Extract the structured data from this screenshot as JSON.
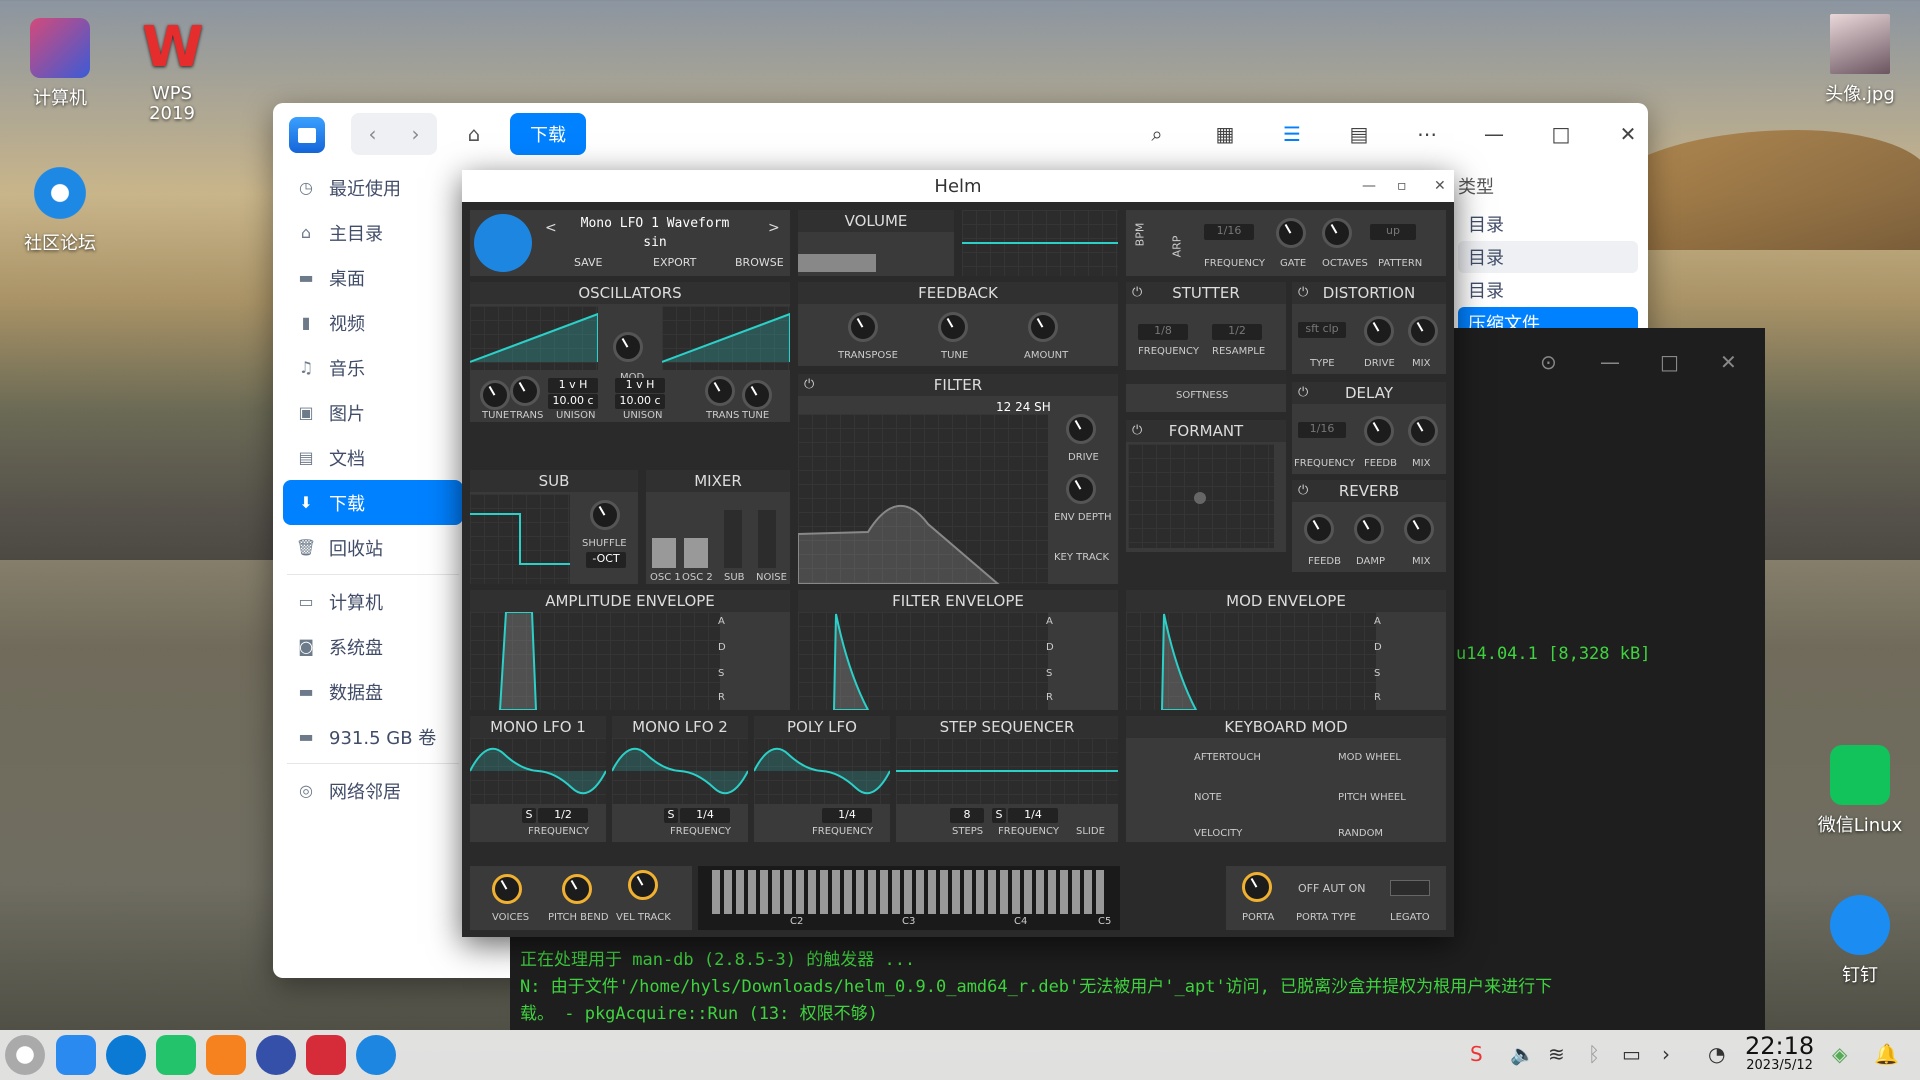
{
  "desktop": {
    "icons": [
      {
        "label": "计算机"
      },
      {
        "label": "WPS 2019"
      },
      {
        "label": "社区论坛"
      },
      {
        "label": "头像.jpg"
      },
      {
        "label": "微信Linux"
      },
      {
        "label": "钉钉"
      }
    ]
  },
  "file_manager": {
    "breadcrumb": "下载",
    "sidebar": [
      {
        "label": "最近使用",
        "icon": "clock-icon"
      },
      {
        "label": "主目录",
        "icon": "home-icon"
      },
      {
        "label": "桌面",
        "icon": "desktop-icon"
      },
      {
        "label": "视频",
        "icon": "video-icon"
      },
      {
        "label": "音乐",
        "icon": "music-icon"
      },
      {
        "label": "图片",
        "icon": "picture-icon"
      },
      {
        "label": "文档",
        "icon": "document-icon"
      },
      {
        "label": "下载",
        "icon": "download-icon",
        "active": true
      },
      {
        "label": "回收站",
        "icon": "trash-icon"
      },
      {
        "label": "计算机",
        "icon": "computer-icon"
      },
      {
        "label": "系统盘",
        "icon": "disk-icon"
      },
      {
        "label": "数据盘",
        "icon": "disk-icon"
      },
      {
        "label": "931.5 GB 卷",
        "icon": "disk-icon"
      },
      {
        "label": "网络邻居",
        "icon": "network-icon"
      }
    ],
    "type_header": "类型",
    "type_rows": [
      "目录",
      "目录",
      "目录",
      "压缩文件"
    ]
  },
  "terminal": {
    "line_version": "u14.04.1 [8,328 kB]",
    "line1": "正在处理用于 man-db (2.8.5-3) 的触发器 ...",
    "line2": "N: 由于文件'/home/hyls/Downloads/helm_0.9.0_amd64_r.deb'无法被用户'_apt'访问, 已脱离沙盒并提权为根用户来进行下",
    "line3": "载。 - pkgAcquire::Run (13: 权限不够)"
  },
  "helm": {
    "title": "Helm",
    "preset": {
      "name": "Mono LFO 1 Waveform",
      "value": "sin",
      "save": "SAVE",
      "export": "EXPORT",
      "browse": "BROWSE",
      "prev": "<",
      "next": ">"
    },
    "volume": "VOLUME",
    "bpm": "BPM",
    "arp": {
      "label": "ARP",
      "freq_val": "1/16",
      "pattern_val": "up",
      "labels": [
        "FREQUENCY",
        "GATE",
        "OCTAVES",
        "PATTERN"
      ]
    },
    "oscillators": {
      "title": "OSCILLATORS",
      "mod": "MOD",
      "labels": [
        "TUNE",
        "TRANS",
        "UNISON",
        "UNISON",
        "TRANS",
        "TUNE"
      ],
      "unison1": "1 v H",
      "unison1b": "10.00 c",
      "unison2": "1 v H",
      "unison2b": "10.00 c"
    },
    "feedback": {
      "title": "FEEDBACK",
      "labels": [
        "TRANSPOSE",
        "TUNE",
        "AMOUNT"
      ]
    },
    "stutter": {
      "title": "STUTTER",
      "freq_val": "1/8",
      "resample_val": "1/2",
      "labels": [
        "FREQUENCY",
        "RESAMPLE"
      ],
      "softness": "SOFTNESS"
    },
    "distortion": {
      "title": "DISTORTION",
      "type_val": "sft clp",
      "labels": [
        "TYPE",
        "DRIVE",
        "MIX"
      ]
    },
    "filter": {
      "title": "FILTER",
      "modes": "12 24 SH",
      "labels": [
        "DRIVE",
        "ENV DEPTH",
        "KEY TRACK"
      ]
    },
    "delay": {
      "title": "DELAY",
      "freq_val": "1/16",
      "labels": [
        "FREQUENCY",
        "FEEDB",
        "MIX"
      ]
    },
    "formant": {
      "title": "FORMANT"
    },
    "reverb": {
      "title": "REVERB",
      "labels": [
        "FEEDB",
        "DAMP",
        "MIX"
      ]
    },
    "sub": {
      "title": "SUB",
      "shuffle": "SHUFFLE",
      "oct": "-OCT"
    },
    "mixer": {
      "title": "MIXER",
      "labels": [
        "OSC 1",
        "OSC 2",
        "SUB",
        "NOISE"
      ]
    },
    "envelopes": [
      "AMPLITUDE ENVELOPE",
      "FILTER ENVELOPE",
      "MOD ENVELOPE"
    ],
    "adsr": [
      "A",
      "D",
      "S",
      "R"
    ],
    "lfos": [
      {
        "title": "MONO LFO 1",
        "s": "S",
        "val": "1/2",
        "label": "FREQUENCY"
      },
      {
        "title": "MONO LFO 2",
        "s": "S",
        "val": "1/4",
        "label": "FREQUENCY"
      },
      {
        "title": "POLY LFO",
        "s": "",
        "val": "1/4",
        "label": "FREQUENCY"
      }
    ],
    "step_seq": {
      "title": "STEP SEQUENCER",
      "steps_val": "8",
      "s": "S",
      "freq_val": "1/4",
      "labels": [
        "STEPS",
        "FREQUENCY",
        "SLIDE"
      ]
    },
    "keyboard_mod": {
      "title": "KEYBOARD MOD",
      "items": [
        "AFTERTOUCH",
        "MOD WHEEL",
        "NOTE",
        "PITCH WHEEL",
        "VELOCITY",
        "RANDOM"
      ]
    },
    "bottom": {
      "labels": [
        "VOICES",
        "PITCH BEND",
        "VEL TRACK"
      ],
      "keys": [
        "C2",
        "C3",
        "C4",
        "C5"
      ],
      "porta": "PORTA",
      "porta_type": "PORTA TYPE",
      "legato": "LEGATO",
      "porta_opts": "OFF AUT ON"
    }
  },
  "taskbar": {
    "time": "22:18",
    "date": "2023/5/12"
  },
  "colors": {
    "accent": "#0081ff",
    "helm_teal": "#2bd0c8",
    "terminal_green": "#3fd33f"
  }
}
